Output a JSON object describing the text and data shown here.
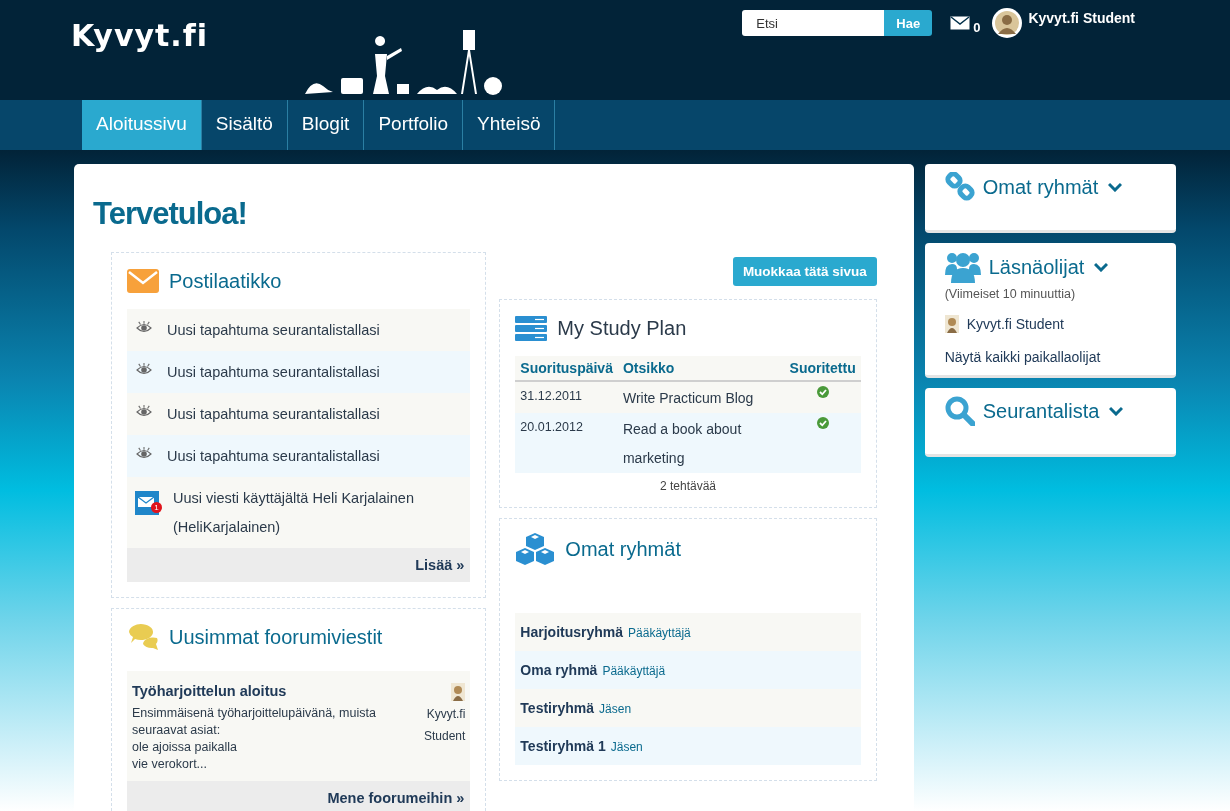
{
  "header": {
    "logo": "Kyvyt.fi",
    "search": {
      "placeholder": "Etsi",
      "button": "Hae"
    },
    "message_count": "0",
    "user": "Kyvyt.fi Student"
  },
  "nav": [
    {
      "label": "Aloitussivu",
      "selected": true
    },
    {
      "label": "Sisältö",
      "selected": false
    },
    {
      "label": "Blogit",
      "selected": false
    },
    {
      "label": "Portfolio",
      "selected": false
    },
    {
      "label": "Yhteisö",
      "selected": false
    }
  ],
  "page_title": "Tervetuloa!",
  "edit_button": "Muokkaa tätä sivua",
  "inbox": {
    "title": "Postilaatikko",
    "items": [
      {
        "kind": "watch",
        "text": "Uusi tapahtuma seurantalistallasi"
      },
      {
        "kind": "watch",
        "text": "Uusi tapahtuma seurantalistallasi"
      },
      {
        "kind": "watch",
        "text": "Uusi tapahtuma seurantalistallasi"
      },
      {
        "kind": "watch",
        "text": "Uusi tapahtuma seurantalistallasi"
      },
      {
        "kind": "message",
        "text": "Uusi viesti käyttäjältä Heli Karjalainen (HeliKarjalainen)",
        "badge": "1"
      }
    ],
    "more": "Lisää »"
  },
  "forum": {
    "title": "Uusimmat foorumiviestit",
    "posts": [
      {
        "title": "Työharjoittelun aloitus",
        "excerpt": "Ensimmäisenä työharjoittelupäivänä, muista seuraavat asiat:\nole ajoissa paikalla\nvie verokort...",
        "author": "Kyvyt.fi Student"
      }
    ],
    "more": "Mene foorumeihin »"
  },
  "study_plan": {
    "title": "My Study Plan",
    "columns": [
      "Suorituspäivä",
      "Otsikko",
      "Suoritettu"
    ],
    "rows": [
      {
        "date": "31.12.2011",
        "title": "Write Practicum Blog",
        "done": true
      },
      {
        "date": "20.01.2012",
        "title": "Read a book about marketing",
        "done": true
      }
    ],
    "footer": "2 tehtävää"
  },
  "groups": {
    "title": "Omat ryhmät",
    "items": [
      {
        "name": "Harjoitusryhmä",
        "role": "Pääkäyttäjä"
      },
      {
        "name": "Oma ryhmä",
        "role": "Pääkäyttäjä"
      },
      {
        "name": "Testiryhmä",
        "role": "Jäsen"
      },
      {
        "name": "Testiryhmä 1",
        "role": "Jäsen"
      }
    ]
  },
  "sidebar": [
    {
      "kind": "groups",
      "title": "Omat ryhmät"
    },
    {
      "kind": "online",
      "title": "Läsnäolijat",
      "subtitle": "(Viimeiset 10 minuuttia)",
      "users": [
        "Kyvyt.fi Student"
      ],
      "link": "Näytä kaikki paikallaolijat"
    },
    {
      "kind": "watchlist",
      "title": "Seurantalista"
    }
  ]
}
